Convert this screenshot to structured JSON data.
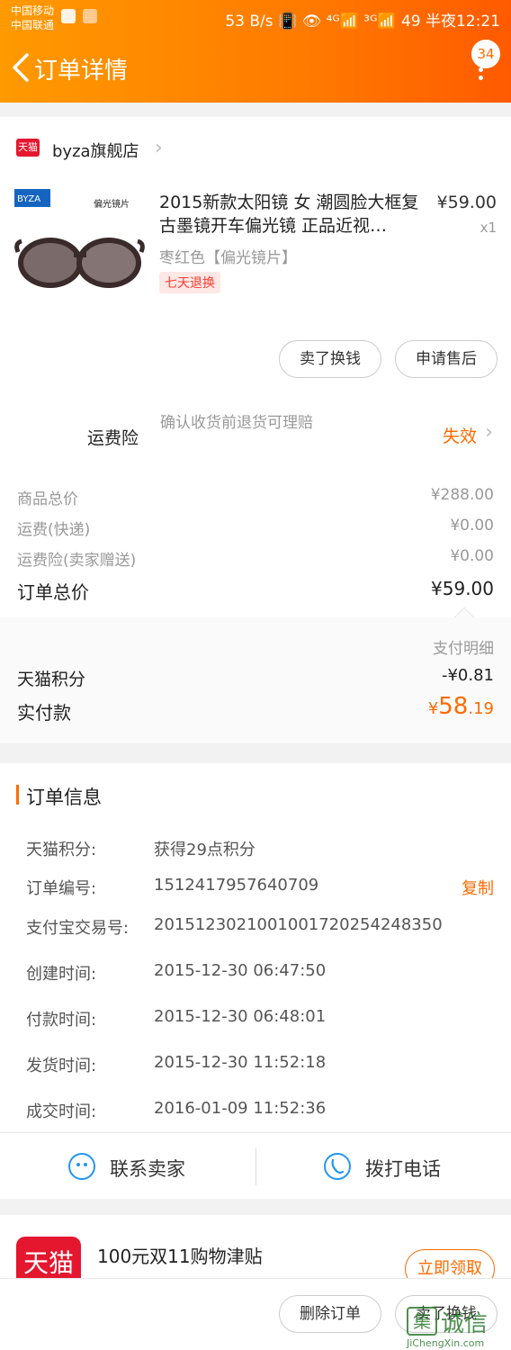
{
  "status_bar": {
    "carrier1": "中国移动",
    "carrier2": "中国联通",
    "right": "53 B/s 📳 👁 ⁴ᴳ📶 ³ᴳ📶 49 半夜12:21"
  },
  "header": {
    "title": "订单详情",
    "badge": "34"
  },
  "shop": {
    "badge": "天猫",
    "name": "byza旗舰店"
  },
  "product": {
    "title": "2015新款太阳镜 女 潮圆脸大框复古墨镜开车偏光镜 正品近视…",
    "price": "¥59.00",
    "qty": "x1",
    "sku": "枣红色【偏光镜片】",
    "tag": "七天退换",
    "brand_text": "BYZA",
    "lens_text": "偏光镜片"
  },
  "actions": {
    "sell_label": "卖了换钱",
    "aftersale_label": "申请售后"
  },
  "insurance": {
    "label": "运费险",
    "desc": "确认收货前退货可理赔",
    "status": "失效"
  },
  "price_lines": [
    {
      "label": "商品总价",
      "value": "¥288.00"
    },
    {
      "label": "运费(快递)",
      "value": "¥0.00"
    },
    {
      "label": "运费险(卖家赠送)",
      "value": "¥0.00"
    }
  ],
  "order_total": {
    "label": "订单总价",
    "value": "¥59.00"
  },
  "payment": {
    "detail_link": "支付明细",
    "points_label": "天猫积分",
    "points_value": "-¥0.81",
    "paid_label": "实付款",
    "paid_currency": "¥",
    "paid_int": "58",
    "paid_dec": ".19"
  },
  "order_info": {
    "title": "订单信息",
    "copy_label": "复制",
    "rows": [
      {
        "k": "天猫积分:",
        "v": "获得29点积分"
      },
      {
        "k": "订单编号:",
        "v": "1512417957640709"
      },
      {
        "k": "支付宝交易号:",
        "v": "2015123021001001720254248350"
      },
      {
        "k": "创建时间:",
        "v": "2015-12-30 06:47:50"
      },
      {
        "k": "付款时间:",
        "v": "2015-12-30 06:48:01"
      },
      {
        "k": "发货时间:",
        "v": "2015-12-30 11:52:18"
      },
      {
        "k": "成交时间:",
        "v": "2016-01-09 11:52:36"
      }
    ]
  },
  "contact": {
    "seller_label": "联系卖家",
    "phone_label": "拨打电话"
  },
  "promo": {
    "logo": "天猫",
    "text": "100元双11购物津贴",
    "claim_label": "立即领取"
  },
  "bottom": {
    "delete_label": "删除订单",
    "sell_label": "卖了换钱"
  },
  "watermark": {
    "box": "集",
    "text": "诚信",
    "url": "JiChengXin.com"
  },
  "colors": {
    "accent": "#ff6a00",
    "tmall_red": "#e4172f",
    "contact_blue": "#2196f3"
  }
}
